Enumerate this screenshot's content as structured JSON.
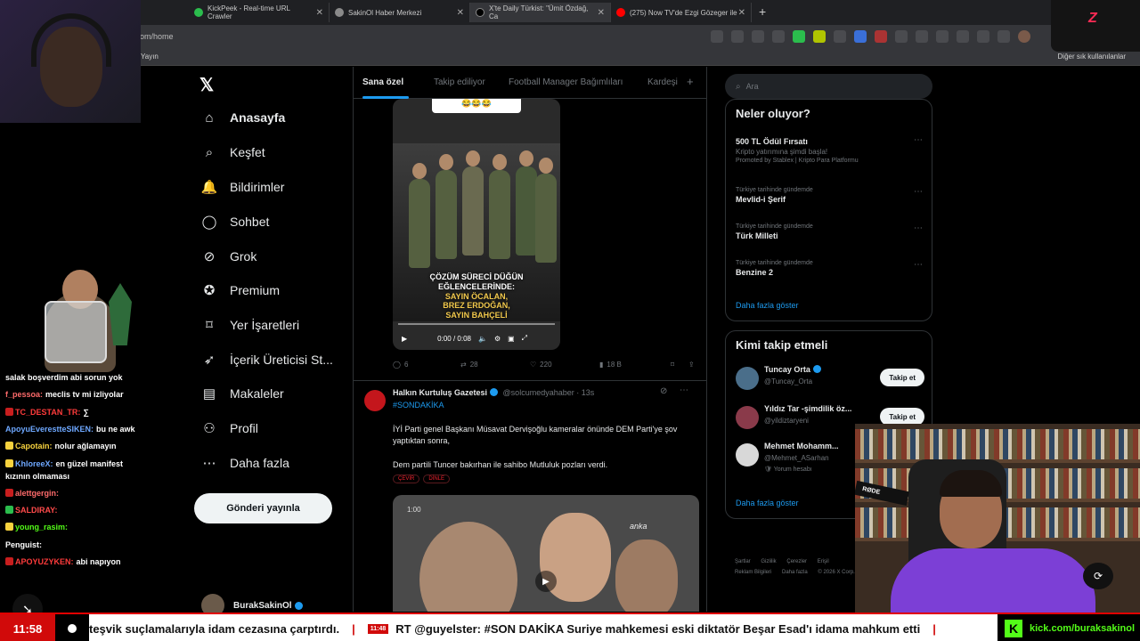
{
  "browser": {
    "tabs": [
      {
        "title": "KickPeek - Real-time URL Crawler",
        "fav": "#2bbd4d"
      },
      {
        "title": "SakinOl Haber Merkezi",
        "fav": "#8a8a8a"
      },
      {
        "title": "X'te Daily Türkist: \"Ümit Özdağ, Ca",
        "fav": "#000000"
      },
      {
        "title": "(275) Now TV'de Ezgi Gözeger ile",
        "fav": "#ff0000"
      }
    ],
    "address": ".com/home",
    "bookmark_left": "Yayın",
    "bookmark_right": "Diğer sık kullanılanlar"
  },
  "x": {
    "logo": "𝕏",
    "nav": [
      {
        "label": "Anasayfa",
        "icon": "home-icon",
        "glyph": "⌂"
      },
      {
        "label": "Keşfet",
        "icon": "search-icon",
        "glyph": "⌕"
      },
      {
        "label": "Bildirimler",
        "icon": "bell-icon",
        "glyph": "🔔"
      },
      {
        "label": "Sohbet",
        "icon": "chat-icon",
        "glyph": "◯"
      },
      {
        "label": "Grok",
        "icon": "grok-icon",
        "glyph": "⊘"
      },
      {
        "label": "Premium",
        "icon": "premium-icon",
        "glyph": "✪"
      },
      {
        "label": "Yer İşaretleri",
        "icon": "bookmark-icon",
        "glyph": "⌑"
      },
      {
        "label": "İçerik Üreticisi St...",
        "icon": "rocket-icon",
        "glyph": "➶"
      },
      {
        "label": "Makaleler",
        "icon": "article-icon",
        "glyph": "▤"
      },
      {
        "label": "Profil",
        "icon": "profile-icon",
        "glyph": "⚇"
      },
      {
        "label": "Daha fazla",
        "icon": "more-icon",
        "glyph": "⋯"
      }
    ],
    "post_button": "Gönderi yayınla",
    "profile_name": "BurakSakinOl",
    "feed_tabs": [
      "Sana özel",
      "Takip ediliyor",
      "Football Manager Bağımlıları",
      "Kardeşi"
    ],
    "tweet1": {
      "emoji": "😂😂😂",
      "caption_line1": "ÇÖZÜM SÜRECİ DÜĞÜN EĞLENCELERİNDE:",
      "caption_line2": "SAYIN ÖCALAN,",
      "caption_line3": "BREZ ERDOĞAN,",
      "caption_line4": "SAYIN BAHÇELİ",
      "time": "0:00 / 0:08",
      "replies": "6",
      "retweets": "28",
      "likes": "220",
      "views": "18 B"
    },
    "tweet2": {
      "name": "Halkın Kurtuluş Gazetesi",
      "meta": "@solcumedyahaber · 13s",
      "hashtag": "#SONDAKİKA",
      "text1": "İYİ Parti genel Başkanı Müsavat Dervişoğlu kameralar önünde DEM Parti'ye şov yaptıktan sonra,",
      "text2": "Dem partili Tuncer bakırhan ile sahibo Mutluluk pozları verdi.",
      "tag1": "ÇEVİR",
      "tag2": "DİNLE",
      "video_brand": "anka",
      "video_time": "1:00"
    },
    "right": {
      "search_placeholder": "Ara",
      "whats_happening": "Neler oluyor?",
      "trends": [
        {
          "ctx": "",
          "title": "500 TL Ödül Fırsatı",
          "sub": "Kripto yatırımına şimdi başla!",
          "promo": "Promoted by Stablex | Kripto Para Platformu"
        },
        {
          "ctx": "Türkiye tarihinde gündemde",
          "title": "Mevlid-i Şerif",
          "sub": "",
          "promo": ""
        },
        {
          "ctx": "Türkiye tarihinde gündemde",
          "title": "Türk Milleti",
          "sub": "",
          "promo": ""
        },
        {
          "ctx": "Türkiye tarihinde gündemde",
          "title": "Benzine 2",
          "sub": "",
          "promo": ""
        }
      ],
      "show_more": "Daha fazla göster",
      "who_to_follow": "Kimi takip etmeli",
      "suggestions": [
        {
          "name": "Tuncay Orta",
          "handle": "@Tuncay_Orta",
          "extra": "",
          "color": "#4a6e8a"
        },
        {
          "name": "Yıldız Tar -şimdilik öz...",
          "handle": "@yildiztaryeni",
          "extra": "",
          "color": "#8a3a4a"
        },
        {
          "name": "Mehmet Mohamm...",
          "handle": "@Mehmet_ASarhan",
          "extra": "Yorum hesabı",
          "color": "#d8d8d8"
        }
      ],
      "follow_label": "Takip et",
      "show_more2": "Daha fazla göster",
      "footer": [
        "Şartlar",
        "Gizlilik",
        "Çerezler",
        "Erişil",
        "Reklam Bilgileri",
        "Daha fazla",
        "© 2026 X Corp."
      ]
    }
  },
  "stream": {
    "chat": [
      {
        "user": "",
        "msg": "salak boşverdim abi sorun yok",
        "color": "#ffffff",
        "badge": ""
      },
      {
        "user": "f_pessoa:",
        "msg": "meclis tv mi izliyolar",
        "color": "#ff6b6b",
        "badge": ""
      },
      {
        "user": "TC_DESTAN_TR:",
        "msg": "∑",
        "color": "#ff3b3b",
        "badge": "#c81e1e"
      },
      {
        "user": "ApoyuEverestteSIKEN:",
        "msg": "bu ne awk",
        "color": "#6ea8ff",
        "badge": ""
      },
      {
        "user": "Capotain:",
        "msg": "nolur ağlamayın",
        "color": "#f7d23e",
        "badge": "#f7d23e"
      },
      {
        "user": "KhloreeX:",
        "msg": "en güzel manifest",
        "color": "#6ea8ff",
        "badge": "#f7d23e"
      },
      {
        "user": "",
        "msg": "kızının olmaması",
        "color": "#ffffff",
        "badge": ""
      },
      {
        "user": "alettgergin:",
        "msg": "",
        "color": "#ff6b6b",
        "badge": "#c81e1e"
      },
      {
        "user": "SALDIRAY:",
        "msg": "",
        "color": "#ff4b4b",
        "badge": "#2bbd4d"
      },
      {
        "user": "young_rasim:",
        "msg": "",
        "color": "#53fc18",
        "badge": "#f7d23e"
      },
      {
        "user": "Penguist:",
        "msg": "",
        "color": "#ffffff",
        "badge": ""
      },
      {
        "user": "APOYUZYKEN:",
        "msg": "abi napıyon",
        "color": "#ff3b3b",
        "badge": "#c81e1e"
      }
    ],
    "clock": "11:58",
    "ticker_text1": "teşvik suçlamalarıyla idam cezasına çarptırdı.",
    "ticker_time": "11:48",
    "ticker_text2": "RT @guyelster: #SON DAKİKA Suriye mahkemesi eski diktatör Beşar Esad'ı idama mahkum etti",
    "kick_url": "kick.com/buraksakinol",
    "cam_label": "RØDE"
  }
}
